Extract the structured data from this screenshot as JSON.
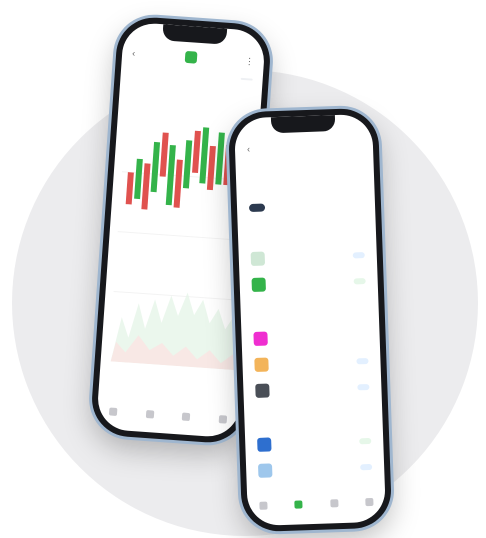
{
  "colors": {
    "background_circle": "#ececee",
    "frame": "#9fb6cf",
    "bull": "#34b34a",
    "bear": "#e0524f",
    "navy": "#2c3a4f"
  },
  "phone_a": {
    "tabs": [],
    "sub_label": "",
    "row_left": "",
    "row_right": "",
    "x_ticks": [],
    "nav_items": []
  },
  "phone_b": {
    "title": "",
    "segments": [],
    "sections": [],
    "nav_items": []
  }
}
